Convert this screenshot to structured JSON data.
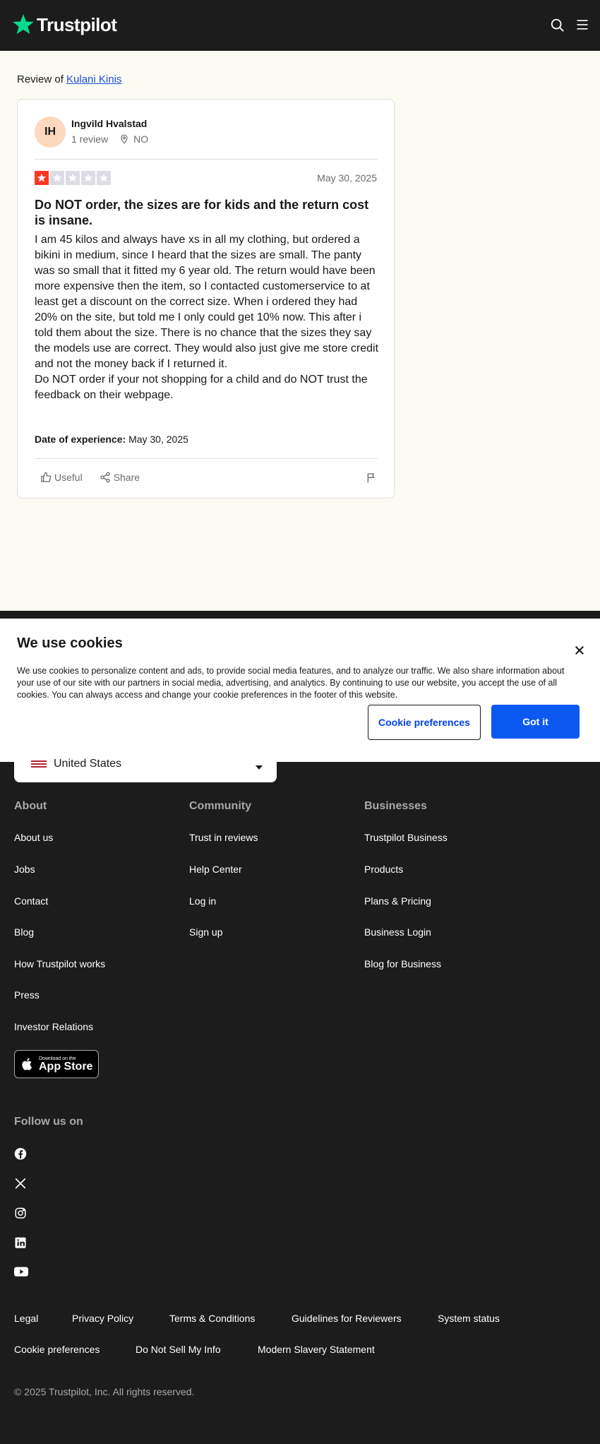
{
  "header": {
    "brand": "Trustpilot",
    "brand_color": "#04da8d",
    "icons": [
      "search-icon",
      "menu-icon"
    ]
  },
  "review_page": {
    "review_of_prefix": "Review of",
    "business_name": "Kulani Kinis",
    "reviewer": {
      "initials": "IH",
      "name": "Ingvild Hvalstad",
      "review_count": "1 review",
      "country": "NO"
    },
    "rating": 1,
    "rating_max": 5,
    "rating_color": "#ff3722",
    "date": "May 30, 2025",
    "title": "Do NOT order, the sizes are for kids and the return cost is insane.",
    "body_lines": [
      "I am 45 kilos and always have xs in all my clothing, but ordered a bikini in medium, since I heard that the sizes are small. The panty was so small that it fitted my 6 year old. The return would have been more expensive then the item, so I contacted customerservice to at least get a discount on the correct size. When i ordered they had 20% on the site, but told me I only could get 10% now. This after i told them about the size. There is no chance that the sizes they say the models use are correct. They would also just give me store credit and not the money back if I returned it.",
      "Do NOT order if your not shopping for a child and do NOT trust the feedback on their webpage."
    ],
    "experience_label": "Date of experience:",
    "experience_date": "May 30, 2025",
    "useful_label": "Useful",
    "share_label": "Share"
  },
  "cookie_banner": {
    "title": "We use cookies",
    "text": "We use cookies to personalize content and ads, to provide social media features, and to analyze our traffic. We also share information about your use of our site with our partners in social media, advertising, and analytics. By continuing to use our website, you accept the use of all cookies. You can always access and change your cookie preferences in the footer of this website.",
    "preferences_label": "Cookie preferences",
    "accept_label": "Got it",
    "accent": "#0c59f2"
  },
  "footer": {
    "country_selector": "United States",
    "columns": [
      {
        "heading": "About",
        "links": [
          "About us",
          "Jobs",
          "Contact",
          "Blog",
          "How Trustpilot works",
          "Press",
          "Investor Relations"
        ]
      },
      {
        "heading": "Community",
        "links": [
          "Trust in reviews",
          "Help Center",
          "Log in",
          "Sign up"
        ]
      },
      {
        "heading": "Businesses",
        "links": [
          "Trustpilot Business",
          "Products",
          "Plans & Pricing",
          "Business Login",
          "Blog for Business"
        ]
      }
    ],
    "app_store": {
      "small": "Download on the",
      "big": "App Store"
    },
    "follow_heading": "Follow us on",
    "social_icons": [
      "facebook-icon",
      "x-icon",
      "instagram-icon",
      "linkedin-icon",
      "youtube-icon"
    ],
    "legal_row1": [
      "Legal",
      "Privacy Policy",
      "Terms & Conditions",
      "Guidelines for Reviewers",
      "System status"
    ],
    "legal_row2": [
      "Cookie preferences",
      "Do Not Sell My Info",
      "Modern Slavery Statement"
    ],
    "copyright": "© 2025 Trustpilot, Inc. All rights reserved."
  }
}
